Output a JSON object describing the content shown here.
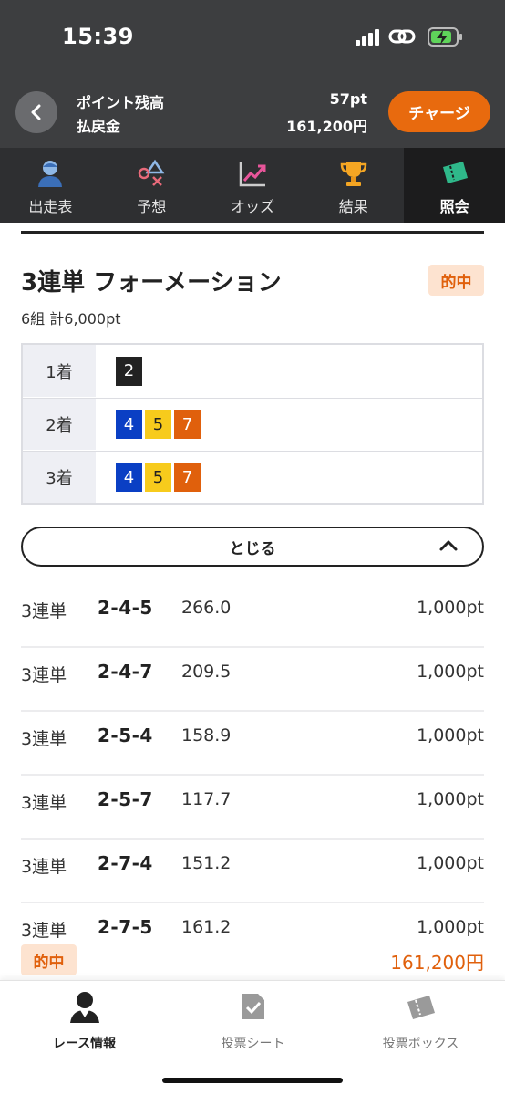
{
  "status": {
    "time": "15:39"
  },
  "header": {
    "points_label": "ポイント残高",
    "points_value": "57pt",
    "refund_label": "払戻金",
    "refund_value": "161,200円",
    "charge_label": "チャージ"
  },
  "tabs": [
    {
      "label": "出走表",
      "icon": "person-icon"
    },
    {
      "label": "予想",
      "icon": "shapes-icon"
    },
    {
      "label": "オッズ",
      "icon": "trend-chart-icon"
    },
    {
      "label": "結果",
      "icon": "trophy-icon"
    },
    {
      "label": "照会",
      "icon": "ticket-icon",
      "active": true
    }
  ],
  "bet": {
    "title": "3連単 フォーメーション",
    "hit_badge": "的中",
    "summary": "6組 計6,000pt"
  },
  "formation": [
    {
      "place": "1着",
      "numbers": [
        "2"
      ]
    },
    {
      "place": "2着",
      "numbers": [
        "4",
        "5",
        "7"
      ]
    },
    {
      "place": "3着",
      "numbers": [
        "4",
        "5",
        "7"
      ]
    }
  ],
  "number_colors": {
    "2": {
      "bg": "#222222",
      "fg": "#ffffff"
    },
    "4": {
      "bg": "#0a3fc4",
      "fg": "#ffffff"
    },
    "5": {
      "bg": "#f7cb1c",
      "fg": "#222222"
    },
    "7": {
      "bg": "#e0600c",
      "fg": "#ffffff"
    }
  },
  "close_label": "とじる",
  "rows": [
    {
      "type": "3連単",
      "combo": "2-4-5",
      "odds": "266.0",
      "amount": "1,000pt"
    },
    {
      "type": "3連単",
      "combo": "2-4-7",
      "odds": "209.5",
      "amount": "1,000pt"
    },
    {
      "type": "3連単",
      "combo": "2-5-4",
      "odds": "158.9",
      "amount": "1,000pt"
    },
    {
      "type": "3連単",
      "combo": "2-5-7",
      "odds": "117.7",
      "amount": "1,000pt"
    },
    {
      "type": "3連単",
      "combo": "2-7-4",
      "odds": "151.2",
      "amount": "1,000pt"
    },
    {
      "type": "3連単",
      "combo": "2-7-5",
      "odds": "161.2",
      "amount": "1,000pt"
    }
  ],
  "result": {
    "hit_badge": "的中",
    "payout": "161,200円"
  },
  "bottom_nav": [
    {
      "label": "レース情報",
      "icon": "racer-icon",
      "active": true
    },
    {
      "label": "投票シート",
      "icon": "vote-sheet-icon"
    },
    {
      "label": "投票ボックス",
      "icon": "ticket-box-icon"
    }
  ],
  "colors": {
    "accent": "#e86a0e",
    "hit_text": "#e0600c",
    "hit_bg": "#fde3d0",
    "header_bg": "#3d3e40"
  }
}
